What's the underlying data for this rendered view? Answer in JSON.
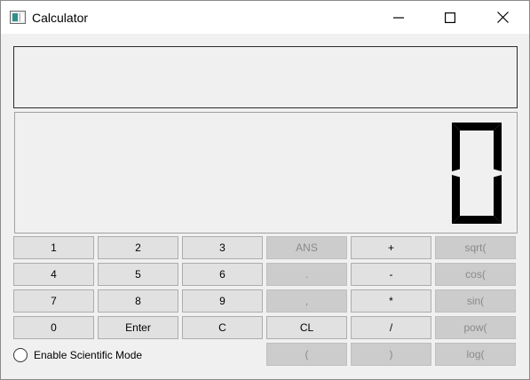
{
  "window": {
    "title": "Calculator",
    "icon": "calculator-app-icon"
  },
  "title_controls": {
    "minimize": "minimize-icon",
    "maximize": "maximize-icon",
    "close": "close-icon"
  },
  "history": {
    "text": ""
  },
  "display": {
    "value": "0"
  },
  "keys": {
    "k1": "1",
    "k2": "2",
    "k3": "3",
    "ans": "ANS",
    "plus": "+",
    "sqrt": "sqrt(",
    "k4": "4",
    "k5": "5",
    "k6": "6",
    "dot": ".",
    "minus": "-",
    "cos": "cos(",
    "k7": "7",
    "k8": "8",
    "k9": "9",
    "comma": ",",
    "mult": "*",
    "sin": "sin(",
    "k0": "0",
    "enter": "Enter",
    "c": "C",
    "cl": "CL",
    "div": "/",
    "pow": "pow(",
    "lparen": "(",
    "rparen": ")",
    "log": "log("
  },
  "scientific_mode": {
    "label": "Enable Scientific Mode",
    "checked": false
  },
  "colors": {
    "lcd_digit": "#000000",
    "button_bg": "#e1e1e1",
    "button_disabled_bg": "#cccccc",
    "button_disabled_text": "#8a8a8a"
  }
}
